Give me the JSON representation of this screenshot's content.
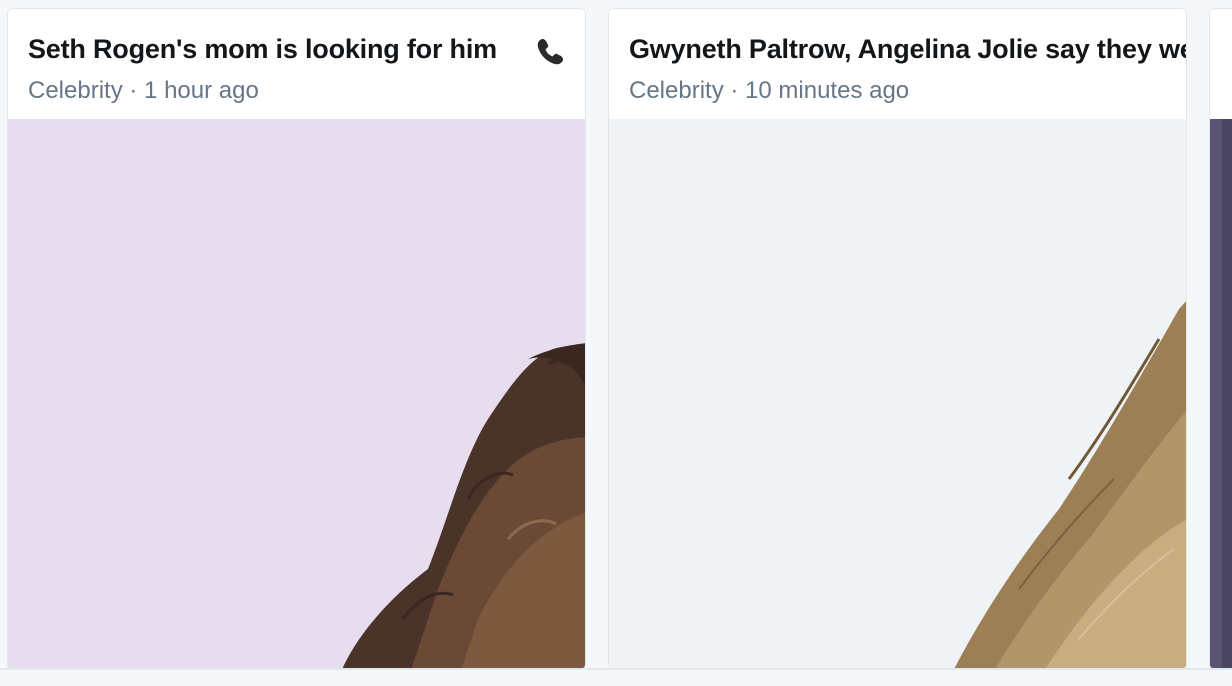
{
  "cards": [
    {
      "headline": "Seth Rogen's mom is looking for him",
      "headline_icon": "telephone-receiver-icon",
      "category": "Celebrity",
      "separator": "·",
      "time": "1 hour ago",
      "image_bg": "#e8dcef",
      "hair_color": "#4a3328"
    },
    {
      "headline": "Gwyneth Paltrow, Angelina Jolie say they were",
      "category": "Celebrity",
      "separator": "·",
      "time": "10 minutes ago",
      "image_bg": "#eff3f6",
      "hair_color": "#8a6f47"
    },
    {
      "headline": "",
      "image_bg": "#4a4560"
    }
  ],
  "colors": {
    "headline": "#14171a",
    "meta": "#657786",
    "border": "#e1e8ed"
  }
}
